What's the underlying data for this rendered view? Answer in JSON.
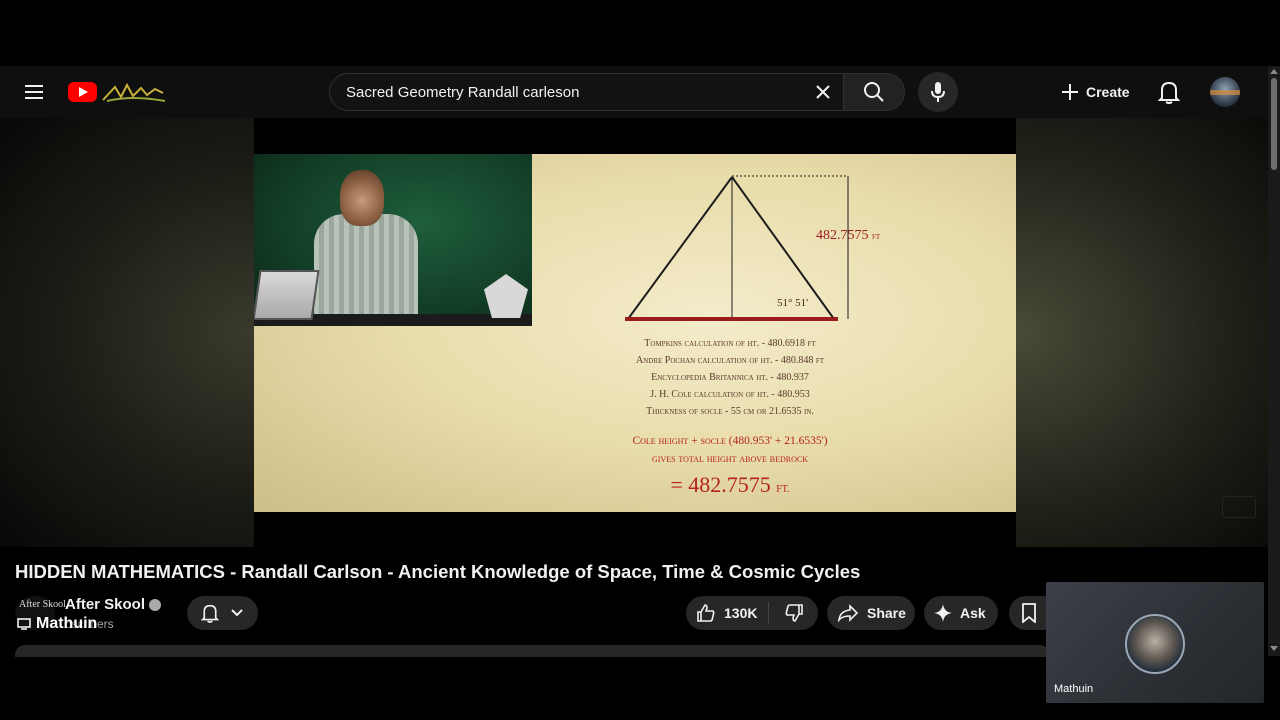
{
  "masthead": {
    "search_query": "Sacred Geometry Randall carleson",
    "create_label": "Create"
  },
  "slide": {
    "height_label": "482.7575",
    "height_unit": "FT",
    "angle_label": "51° 51'",
    "calc_lines": [
      "Tompkins calculation of ht. - 480.6918 ft",
      "Andre Pochan calculation of ht. - 480.848 ft",
      "Encyclopedia Britannica ht. - 480.937",
      "J. H. Cole calculation of ht. - 480.953",
      "Thickness of socle - 55 cm or 21.6535 in."
    ],
    "red_lines": [
      "Cole height + socle (480.953' + 21.6535')",
      "gives total height above bedrock"
    ],
    "total_prefix": "=",
    "total_value": "482.7575",
    "total_unit": "FT."
  },
  "video": {
    "title": "HIDDEN MATHEMATICS - Randall Carlson - Ancient Knowledge of Space, Time & Cosmic Cycles"
  },
  "channel": {
    "avatar_text": "After Skool",
    "name": "After Skool",
    "subscribers": "bscribers",
    "overlay_user": "Mathuin"
  },
  "actions": {
    "likes": "130K",
    "share_label": "Share",
    "ask_label": "Ask"
  },
  "mini_window": {
    "name": "Mathuin"
  },
  "colors": {
    "youtube_red": "#ff0000",
    "slide_red": "#b52121",
    "background": "#0f0f0f",
    "pill": "#272727"
  }
}
